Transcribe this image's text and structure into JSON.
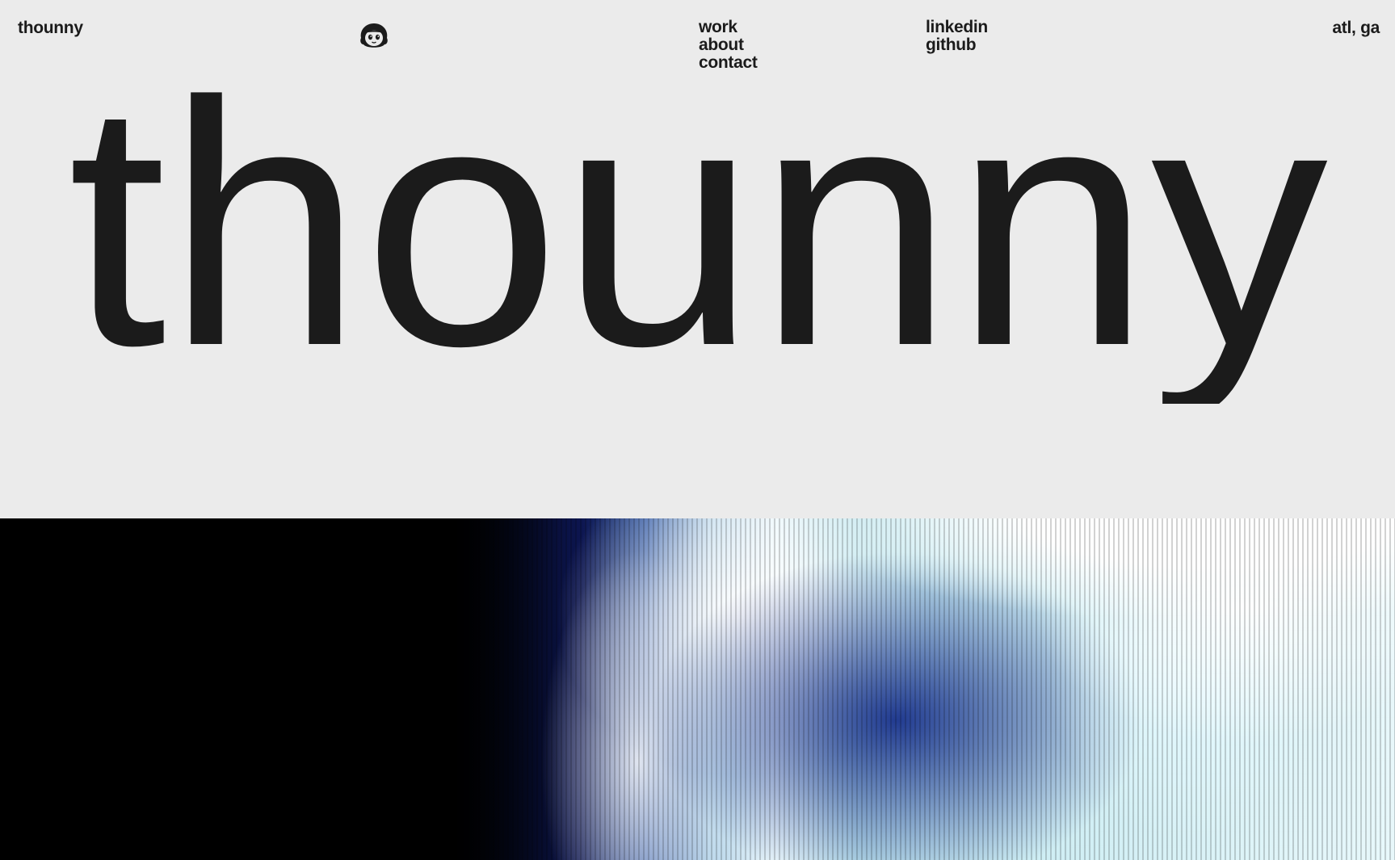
{
  "header": {
    "brand": "thounny",
    "nav": [
      "work",
      "about",
      "contact"
    ],
    "social": [
      "linkedin",
      "github"
    ],
    "location": "atl, ga",
    "avatar_icon": "cartoon-face-icon"
  },
  "hero": {
    "title": "thounny"
  },
  "colors": {
    "background": "#ebebeb",
    "text": "#1b1b1b",
    "media_dark": "#000000",
    "media_blue": "#19328c",
    "media_light": "#e8f8fb"
  }
}
